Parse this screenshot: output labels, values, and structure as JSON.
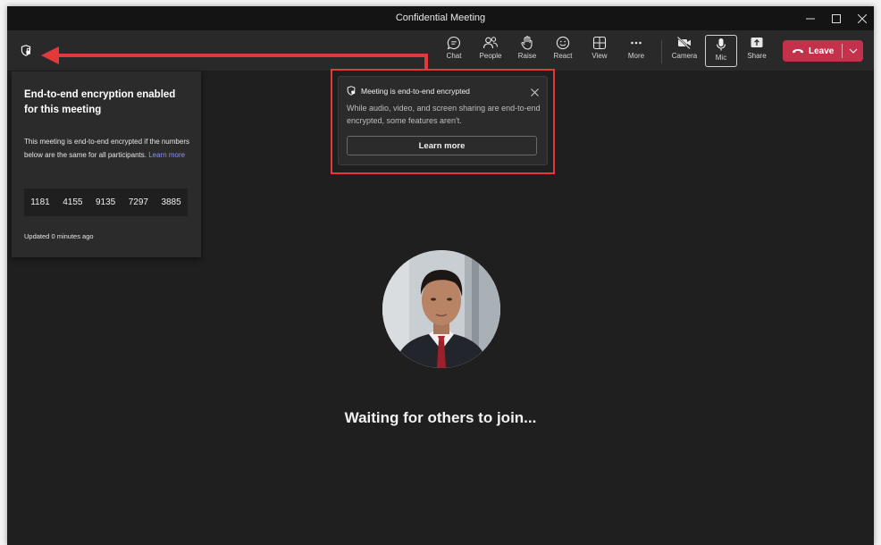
{
  "window": {
    "title": "Confidential Meeting"
  },
  "toolbar": {
    "items": [
      {
        "label": "Chat",
        "icon": "chat-icon"
      },
      {
        "label": "People",
        "icon": "people-icon"
      },
      {
        "label": "Raise",
        "icon": "raise-hand-icon"
      },
      {
        "label": "React",
        "icon": "react-smiley-icon"
      },
      {
        "label": "View",
        "icon": "view-grid-icon"
      },
      {
        "label": "More",
        "icon": "more-icon"
      },
      {
        "label": "Camera",
        "icon": "camera-off-icon"
      },
      {
        "label": "Mic",
        "icon": "mic-icon"
      },
      {
        "label": "Share",
        "icon": "share-icon"
      }
    ],
    "leave_label": "Leave",
    "leave_color": "#c4314b"
  },
  "encryption_panel": {
    "title": "End-to-end encryption enabled for this meeting",
    "body": "This meeting is end-to-end encrypted if the numbers below are the same for all participants.",
    "link": "Learn more",
    "codes": [
      "1181",
      "4155",
      "9135",
      "7297",
      "3885"
    ],
    "updated": "Updated 0 minutes ago"
  },
  "popup": {
    "title": "Meeting is end-to-end encrypted",
    "text": "While audio, video, and screen sharing are end-to-end encrypted, some features aren't.",
    "button": "Learn more"
  },
  "stage": {
    "waiting_text": "Waiting for others to join..."
  },
  "colors": {
    "background": "#1f1f1f",
    "toolbar": "#292929",
    "annotation": "#e23a3a",
    "link": "#8b8ef5"
  }
}
